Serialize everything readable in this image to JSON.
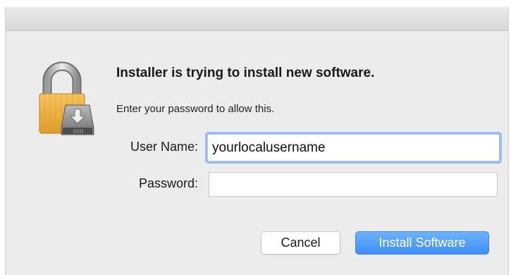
{
  "dialog": {
    "title": "Installer is trying to install new software.",
    "message": "Enter your password to allow this.",
    "lock_icon": "padlock-with-installer-disk-icon",
    "fields": {
      "username": {
        "label": "User Name:",
        "value": "yourlocalusername",
        "focused": true
      },
      "password": {
        "label": "Password:",
        "value": ""
      }
    },
    "buttons": {
      "cancel": "Cancel",
      "install": "Install Software"
    }
  },
  "colors": {
    "dialog_background": "#ececec",
    "focus_ring": "#9cbcf0",
    "default_button": "#3e8ff6",
    "lock_gold": "#e9a93a"
  }
}
